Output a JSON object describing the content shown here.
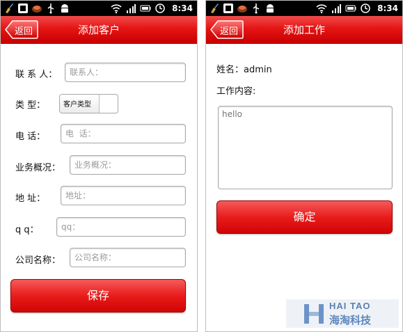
{
  "status_bar": {
    "time": "8:34",
    "icons_left": [
      "broom-icon",
      "usb-debug-icon",
      "app-badge-icon",
      "usb-icon",
      "android-icon"
    ],
    "icons_right": [
      "wifi-icon",
      "signal-icon",
      "battery-icon",
      "alarm-icon"
    ]
  },
  "screens": {
    "add_customer": {
      "back_label": "返回",
      "title": "添加客户",
      "fields": [
        {
          "label": "联 系 人：",
          "placeholder": "联系人："
        },
        {
          "label": "类    型：",
          "spinner_text": "客户类型"
        },
        {
          "label": "电    话：",
          "placeholder": "电  话："
        },
        {
          "label": "业务概况：",
          "placeholder": "业务概况："
        },
        {
          "label": "地    址：",
          "placeholder": "地址："
        },
        {
          "label": "q     q：",
          "placeholder": "qq："
        },
        {
          "label": "公司名称：",
          "placeholder": "公司名称："
        }
      ],
      "save_label": "保存"
    },
    "add_work": {
      "back_label": "返回",
      "title": "添加工作",
      "name_line": "姓名：admin",
      "content_label": "工作内容:",
      "content_value": "hello",
      "confirm_label": "确定"
    }
  },
  "watermark": {
    "line1": "HAI TAO",
    "line2": "海淘科技"
  },
  "colors": {
    "accent_red": "#e51515",
    "status_bar": "#000000",
    "watermark_blue": "#5a7fb0"
  }
}
